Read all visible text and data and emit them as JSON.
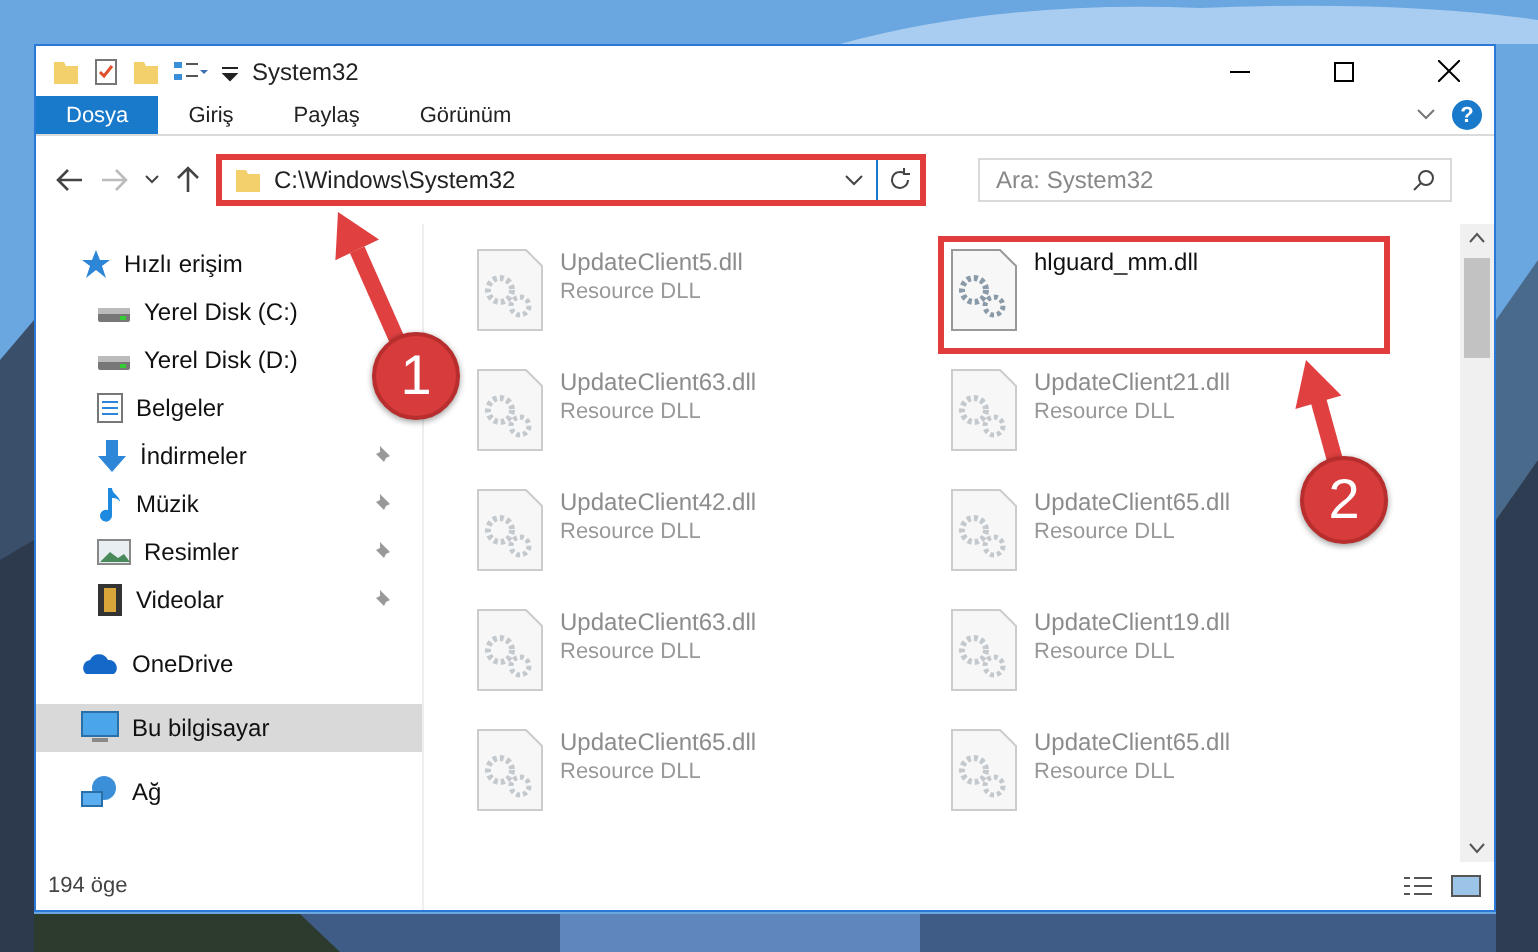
{
  "window": {
    "title": "System32"
  },
  "ribbon": {
    "tabs": [
      {
        "label": "Dosya",
        "selected": true
      },
      {
        "label": "Giriş",
        "selected": false
      },
      {
        "label": "Paylaş",
        "selected": false
      },
      {
        "label": "Görünüm",
        "selected": false
      }
    ],
    "help": "?"
  },
  "address_bar": {
    "path": "C:\\Windows\\System32",
    "highlighted": true
  },
  "search": {
    "placeholder": "Ara: System32"
  },
  "sidebar": {
    "items": [
      {
        "label": "Hızlı erişim",
        "kind": "star",
        "selected": false,
        "children": [
          {
            "label": "Yerel Disk (C:)",
            "kind": "drive",
            "pinned": false,
            "selected": false
          },
          {
            "label": "Yerel Disk (D:)",
            "kind": "drive",
            "pinned": false,
            "selected": false
          },
          {
            "label": "Belgeler",
            "kind": "document",
            "pinned": false,
            "selected": false
          },
          {
            "label": "İndirmeler",
            "kind": "download",
            "pinned": true,
            "selected": false
          },
          {
            "label": "Müzik",
            "kind": "music",
            "pinned": true,
            "selected": false
          },
          {
            "label": "Resimler",
            "kind": "picture",
            "pinned": true,
            "selected": false
          },
          {
            "label": "Videolar",
            "kind": "video",
            "pinned": true,
            "selected": false
          }
        ]
      },
      {
        "label": "OneDrive",
        "kind": "cloud",
        "selected": false
      },
      {
        "label": "Bu bilgisayar",
        "kind": "computer",
        "selected": true
      },
      {
        "label": "Ağ",
        "kind": "network",
        "selected": false
      }
    ]
  },
  "files": [
    {
      "name": "UpdateClient5.dll",
      "type": "Resource DLL",
      "dimmed": true,
      "highlighted": false
    },
    {
      "name": "hlguard_mm.dll",
      "dimmed": false,
      "highlighted": true
    },
    {
      "name": "UpdateClient63.dll",
      "type": "Resource DLL",
      "dimmed": true,
      "highlighted": false
    },
    {
      "name": "UpdateClient21.dll",
      "type": "Resource DLL",
      "dimmed": true,
      "highlighted": false
    },
    {
      "name": "UpdateClient42.dll",
      "type": "Resource DLL",
      "dimmed": true,
      "highlighted": false
    },
    {
      "name": "UpdateClient65.dll",
      "type": "Resource DLL",
      "dimmed": true,
      "highlighted": false
    },
    {
      "name": "UpdateClient63.dll",
      "type": "Resource DLL",
      "dimmed": true,
      "highlighted": false
    },
    {
      "name": "UpdateClient19.dll",
      "type": "Resource DLL",
      "dimmed": true,
      "highlighted": false
    },
    {
      "name": "UpdateClient65.dll",
      "type": "Resource DLL",
      "dimmed": true,
      "highlighted": false
    },
    {
      "name": "UpdateClient65.dll",
      "type": "Resource DLL",
      "dimmed": true,
      "highlighted": false
    }
  ],
  "status_bar": {
    "count": "194 öge"
  },
  "annotations": [
    {
      "label": "1"
    },
    {
      "label": "2"
    }
  ]
}
